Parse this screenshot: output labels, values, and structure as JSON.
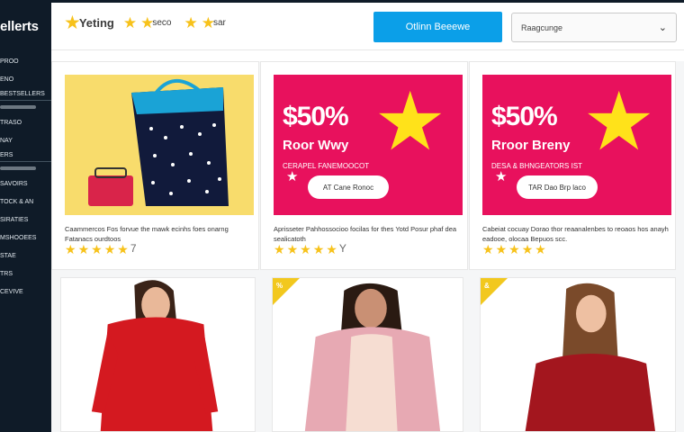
{
  "sidebar": {
    "brand": "ellerts",
    "items": [
      {
        "label": "PROO"
      },
      {
        "label": "ENO"
      },
      {
        "label": "BESTSELLERS"
      },
      {
        "label": ""
      },
      {
        "label": "TRASO"
      },
      {
        "label": "NAY"
      },
      {
        "label": "ERS"
      },
      {
        "label": ""
      },
      {
        "label": "SAVOIRS"
      },
      {
        "label": "TOCK & AN"
      },
      {
        "label": "SIRATIES"
      },
      {
        "label": "MSHOOEES"
      },
      {
        "label": "STAE"
      },
      {
        "label": "TRS"
      },
      {
        "label": "CEVIVE"
      }
    ]
  },
  "header": {
    "rating_label_1": "Yeting",
    "rating_label_2": "seco",
    "rating_label_3": "sar",
    "online_button": "Otlinn Beeewe",
    "sort_select": "Raagcunge"
  },
  "products": [
    {
      "desc": "Caammercos Fos forvue the mawk ecinhs foes onarng Fatanacs ourdtoos",
      "rating": 4,
      "extra_mark": "7"
    },
    {
      "promo_pct": "$50%",
      "promo_sub": "Roor Wwy",
      "promo_small": "CERAPEL FANEMOOCOT",
      "promo_cta": "AT Cane Ronoc",
      "desc": "Aprisseter Pahhossocioo focilas for thes Yotd Posur phaf dea sealicatoth",
      "rating": 5,
      "extra_mark": "Y"
    },
    {
      "promo_pct": "$50%",
      "promo_sub": "Rroor Breny",
      "promo_small": "DESA & BHNGEATORS IST",
      "promo_cta": "TAR Dao Brp laco",
      "desc": "Cabeiat cocuay Dorao thor reaanalenbes to reoaos hos anayh eadooe, olocaa Bepuos scc.",
      "rating": 4,
      "extra_mark": ""
    },
    {
      "tag": ""
    },
    {
      "tag": "%"
    },
    {
      "tag": "&"
    }
  ],
  "colors": {
    "accent": "#0b9fe8",
    "promo": "#e8115d",
    "star": "#f7c21b",
    "sidebar": "#0f1b28",
    "tote_bg": "#f8dc6c"
  }
}
